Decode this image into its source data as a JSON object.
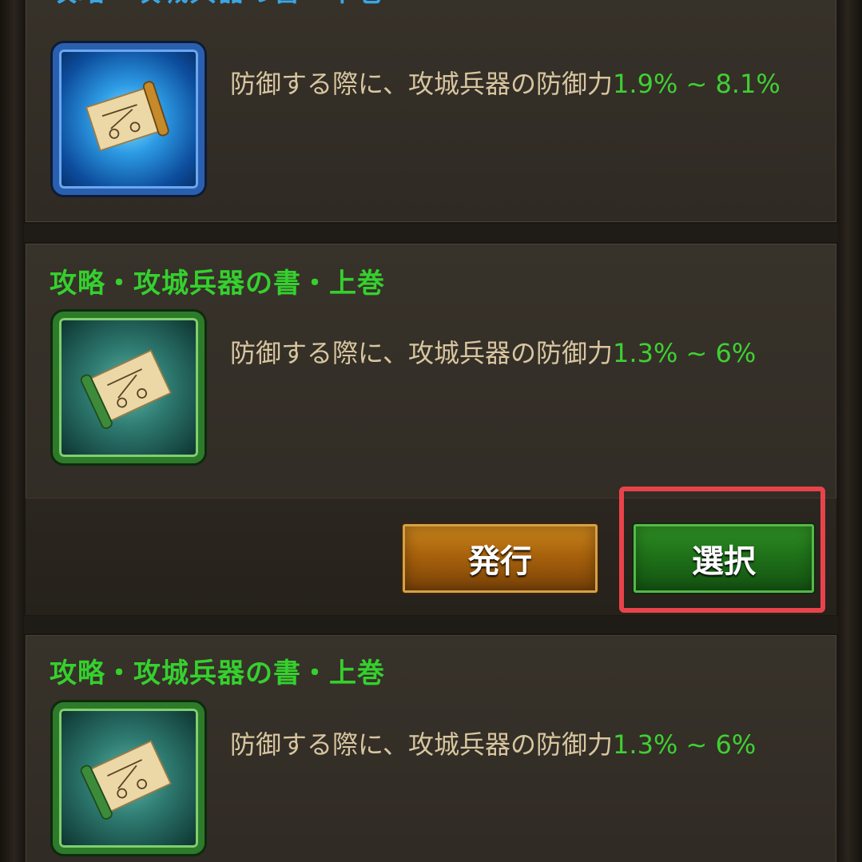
{
  "cards": [
    {
      "title": "攻略・攻城兵器の書・下巻",
      "description": "防御する際に、攻城兵器の防御力",
      "range": "1.9% ~ 8.1%",
      "icon": "blue-scroll-icon",
      "color": "#3aa6e6"
    },
    {
      "title": "攻略・攻城兵器の書・上巻",
      "description": "防御する際に、攻城兵器の防御力",
      "range": "1.3% ~ 6%",
      "icon": "green-scroll-icon",
      "color": "#35d02e"
    },
    {
      "title": "攻略・攻城兵器の書・上巻",
      "description": "防御する際に、攻城兵器の防御力",
      "range": "1.3% ~ 6%",
      "icon": "green-scroll-icon",
      "color": "#35d02e"
    }
  ],
  "buttons": {
    "issue_label": "発行",
    "select_label": "選択"
  },
  "colors": {
    "highlight": "#e8434a",
    "percent": "#3fd033",
    "description": "#d8c6a0"
  }
}
